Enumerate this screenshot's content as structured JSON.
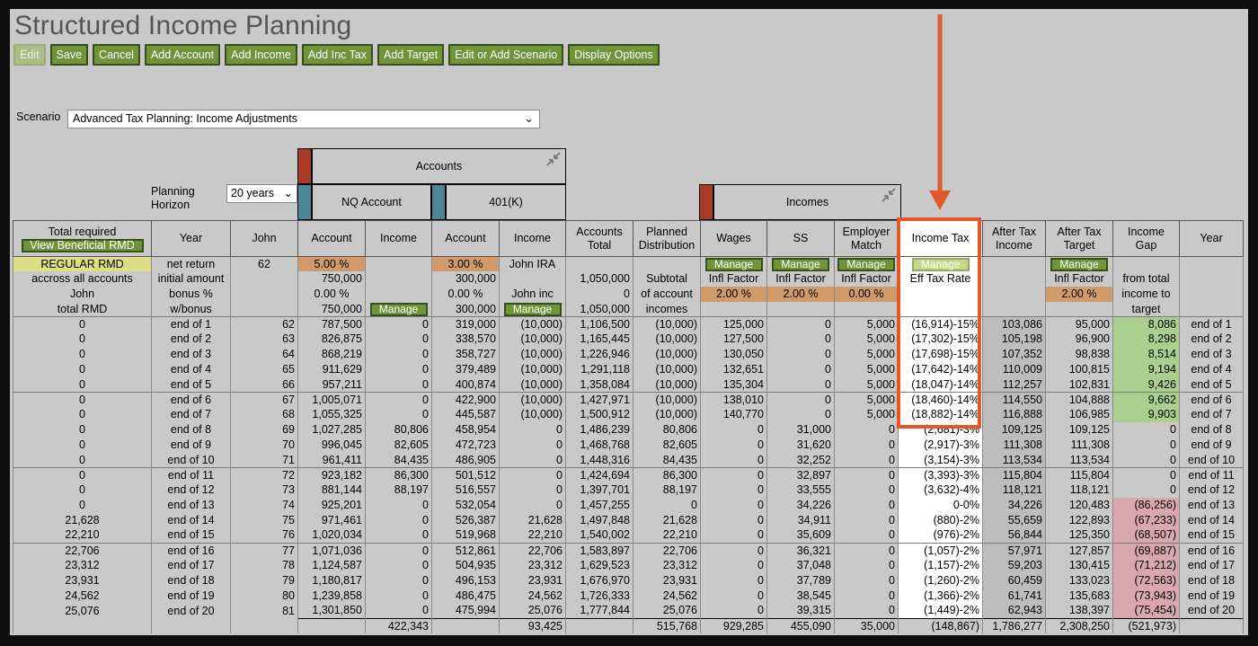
{
  "app": {
    "title": "Structured Income Planning"
  },
  "toolbar": [
    "Edit",
    "Save",
    "Cancel",
    "Add Account",
    "Add Income",
    "Add Inc Tax",
    "Add Target",
    "Edit or Add Scenario",
    "Display Options"
  ],
  "scenario": {
    "label": "Scenario",
    "value": "Advanced Tax Planning: Income Adjustments"
  },
  "planning": {
    "label_1": "Planning",
    "label_2": "Horizon",
    "value": "20 years"
  },
  "groups": {
    "accounts": "Accounts",
    "nq": "NQ Account",
    "k401": "401(K)",
    "incomes": "Incomes"
  },
  "headers": {
    "total_required": "Total required",
    "view_rmd": "View Beneficial RMD",
    "year": "Year",
    "john": "John",
    "account": "Account",
    "income": "Income",
    "accounts_total_1": "Accounts",
    "accounts_total_2": "Total",
    "planned_1": "Planned",
    "planned_2": "Distribution",
    "wages": "Wages",
    "ss": "SS",
    "employer_1": "Employer",
    "employer_2": "Match",
    "income_tax": "Income Tax",
    "after_tax_income_1": "After Tax",
    "after_tax_income_2": "Income",
    "after_tax_target_1": "After Tax",
    "after_tax_target_2": "Target",
    "income_gap_1": "Income",
    "income_gap_2": "Gap",
    "year_right": "Year"
  },
  "setup": {
    "regular_rmd": "REGULAR RMD",
    "across": "accross all accounts",
    "john": "John",
    "total_rmd": "total RMD",
    "net_return": "net return",
    "initial_amount": "initial amount",
    "bonus_pct": "bonus %",
    "w_bonus": "w/bonus",
    "john_age": "62",
    "nq_rate": "5.00  %",
    "nq_initial": "750,000",
    "nq_bonus": "0.00  %",
    "nq_wbonus": "750,000",
    "manage": "Manage",
    "k_rate": "3.00  %",
    "k_initial": "300,000",
    "k_bonus": "0.00  %",
    "k_wbonus": "300,000",
    "john_ira": "John IRA",
    "john_inc": "John inc",
    "total_initial": "1,050,000",
    "total_zero": "0",
    "total_wbonus": "1,050,000",
    "subtotal": "Subtotal",
    "of_account": "of account",
    "incomes_word": "incomes",
    "infl_factor": "Infl Factor",
    "infl_rate": "2.00  %",
    "employer_rate": "0.00  %",
    "eff_tax_rate": "Eff Tax Rate",
    "from_total": "from total",
    "income_to": "income to",
    "target_word": "target"
  },
  "rows": [
    [
      "0",
      "end of 1",
      "62",
      "787,500",
      "0",
      "319,000",
      "(10,000)",
      "1,106,500",
      "(10,000)",
      "125,000",
      "0",
      "5,000",
      "(16,914)-15%",
      "103,086",
      "95,000",
      "8,086",
      "end of 1"
    ],
    [
      "0",
      "end of 2",
      "63",
      "826,875",
      "0",
      "338,570",
      "(10,000)",
      "1,165,445",
      "(10,000)",
      "127,500",
      "0",
      "5,000",
      "(17,302)-15%",
      "105,198",
      "96,900",
      "8,298",
      "end of 2"
    ],
    [
      "0",
      "end of 3",
      "64",
      "868,219",
      "0",
      "358,727",
      "(10,000)",
      "1,226,946",
      "(10,000)",
      "130,050",
      "0",
      "5,000",
      "(17,698)-15%",
      "107,352",
      "98,838",
      "8,514",
      "end of 3"
    ],
    [
      "0",
      "end of 4",
      "65",
      "911,629",
      "0",
      "379,489",
      "(10,000)",
      "1,291,118",
      "(10,000)",
      "132,651",
      "0",
      "5,000",
      "(17,642)-14%",
      "110,009",
      "100,815",
      "9,194",
      "end of 4"
    ],
    [
      "0",
      "end of 5",
      "66",
      "957,211",
      "0",
      "400,874",
      "(10,000)",
      "1,358,084",
      "(10,000)",
      "135,304",
      "0",
      "5,000",
      "(18,047)-14%",
      "112,257",
      "102,831",
      "9,426",
      "end of 5"
    ],
    [
      "0",
      "end of 6",
      "67",
      "1,005,071",
      "0",
      "422,900",
      "(10,000)",
      "1,427,971",
      "(10,000)",
      "138,010",
      "0",
      "5,000",
      "(18,460)-14%",
      "114,550",
      "104,888",
      "9,662",
      "end of 6"
    ],
    [
      "0",
      "end of 7",
      "68",
      "1,055,325",
      "0",
      "445,587",
      "(10,000)",
      "1,500,912",
      "(10,000)",
      "140,770",
      "0",
      "5,000",
      "(18,882)-14%",
      "116,888",
      "106,985",
      "9,903",
      "end of 7"
    ],
    [
      "0",
      "end of 8",
      "69",
      "1,027,285",
      "80,806",
      "458,954",
      "0",
      "1,486,239",
      "80,806",
      "0",
      "31,000",
      "0",
      "(2,681)-3%",
      "109,125",
      "109,125",
      "0",
      "end of 8"
    ],
    [
      "0",
      "end of 9",
      "70",
      "996,045",
      "82,605",
      "472,723",
      "0",
      "1,468,768",
      "82,605",
      "0",
      "31,620",
      "0",
      "(2,917)-3%",
      "111,308",
      "111,308",
      "0",
      "end of 9"
    ],
    [
      "0",
      "end of 10",
      "71",
      "961,411",
      "84,435",
      "486,905",
      "0",
      "1,448,316",
      "84,435",
      "0",
      "32,252",
      "0",
      "(3,154)-3%",
      "113,534",
      "113,534",
      "0",
      "end of 10"
    ],
    [
      "0",
      "end of 11",
      "72",
      "923,182",
      "86,300",
      "501,512",
      "0",
      "1,424,694",
      "86,300",
      "0",
      "32,897",
      "0",
      "(3,393)-3%",
      "115,804",
      "115,804",
      "0",
      "end of 11"
    ],
    [
      "0",
      "end of 12",
      "73",
      "881,144",
      "88,197",
      "516,557",
      "0",
      "1,397,701",
      "88,197",
      "0",
      "33,555",
      "0",
      "(3,632)-4%",
      "118,121",
      "118,121",
      "0",
      "end of 12"
    ],
    [
      "0",
      "end of 13",
      "74",
      "925,201",
      "0",
      "532,054",
      "0",
      "1,457,255",
      "0",
      "0",
      "34,226",
      "0",
      "0-0%",
      "34,226",
      "120,483",
      "(86,256)",
      "end of 13"
    ],
    [
      "21,628",
      "end of 14",
      "75",
      "971,461",
      "0",
      "526,387",
      "21,628",
      "1,497,848",
      "21,628",
      "0",
      "34,911",
      "0",
      "(880)-2%",
      "55,659",
      "122,893",
      "(67,233)",
      "end of 14"
    ],
    [
      "22,210",
      "end of 15",
      "76",
      "1,020,034",
      "0",
      "519,968",
      "22,210",
      "1,540,002",
      "22,210",
      "0",
      "35,609",
      "0",
      "(976)-2%",
      "56,844",
      "125,350",
      "(68,507)",
      "end of 15"
    ],
    [
      "22,706",
      "end of 16",
      "77",
      "1,071,036",
      "0",
      "512,861",
      "22,706",
      "1,583,897",
      "22,706",
      "0",
      "36,321",
      "0",
      "(1,057)-2%",
      "57,971",
      "127,857",
      "(69,887)",
      "end of 16"
    ],
    [
      "23,312",
      "end of 17",
      "78",
      "1,124,587",
      "0",
      "504,935",
      "23,312",
      "1,629,523",
      "23,312",
      "0",
      "37,048",
      "0",
      "(1,157)-2%",
      "59,203",
      "130,415",
      "(71,212)",
      "end of 17"
    ],
    [
      "23,931",
      "end of 18",
      "79",
      "1,180,817",
      "0",
      "496,153",
      "23,931",
      "1,676,970",
      "23,931",
      "0",
      "37,789",
      "0",
      "(1,260)-2%",
      "60,459",
      "133,023",
      "(72,563)",
      "end of 18"
    ],
    [
      "24,562",
      "end of 19",
      "80",
      "1,239,858",
      "0",
      "486,475",
      "24,562",
      "1,726,333",
      "24,562",
      "0",
      "38,545",
      "0",
      "(1,366)-2%",
      "61,741",
      "135,683",
      "(73,943)",
      "end of 19"
    ],
    [
      "25,076",
      "end of 20",
      "81",
      "1,301,850",
      "0",
      "475,994",
      "25,076",
      "1,777,844",
      "25,076",
      "0",
      "39,315",
      "0",
      "(1,449)-2%",
      "62,943",
      "138,397",
      "(75,454)",
      "end of 20"
    ]
  ],
  "totals": [
    "",
    "",
    "",
    "",
    "422,343",
    "",
    "93,425",
    "",
    "515,768",
    "929,285",
    "455,090",
    "35,000",
    "(148,867)",
    "1,786,277",
    "2,308,250",
    "(521,973)",
    ""
  ],
  "colors": {
    "button_green": "#6f943a",
    "highlight_orange": "#e2582a",
    "positive_gap": "#a9d08e",
    "negative_gap": "#d9a8ae"
  }
}
